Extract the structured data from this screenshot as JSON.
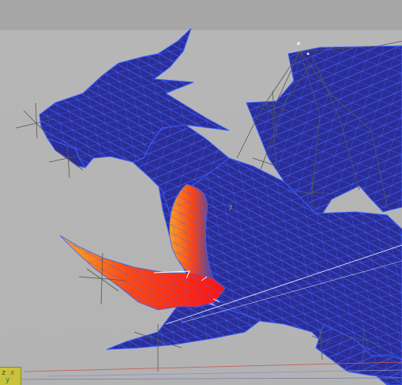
{
  "window": {
    "title": ""
  },
  "viewport": {
    "background_color": "#b3b3b3",
    "mesh_color": "#2b2d96",
    "wire_color": "#3b5cff",
    "highlight_colors": [
      "#ff1a1a",
      "#ff7a1a",
      "#ffb020"
    ],
    "rig_line_color": "#555555"
  },
  "rig": {
    "marker_label": "7"
  },
  "axis_gizmo": {
    "z_label": "z",
    "x_label": "x",
    "y_label": "y"
  },
  "icons": {
    "gizmo": "axis-tripod-icon",
    "bone": "bone-helper-icon"
  }
}
